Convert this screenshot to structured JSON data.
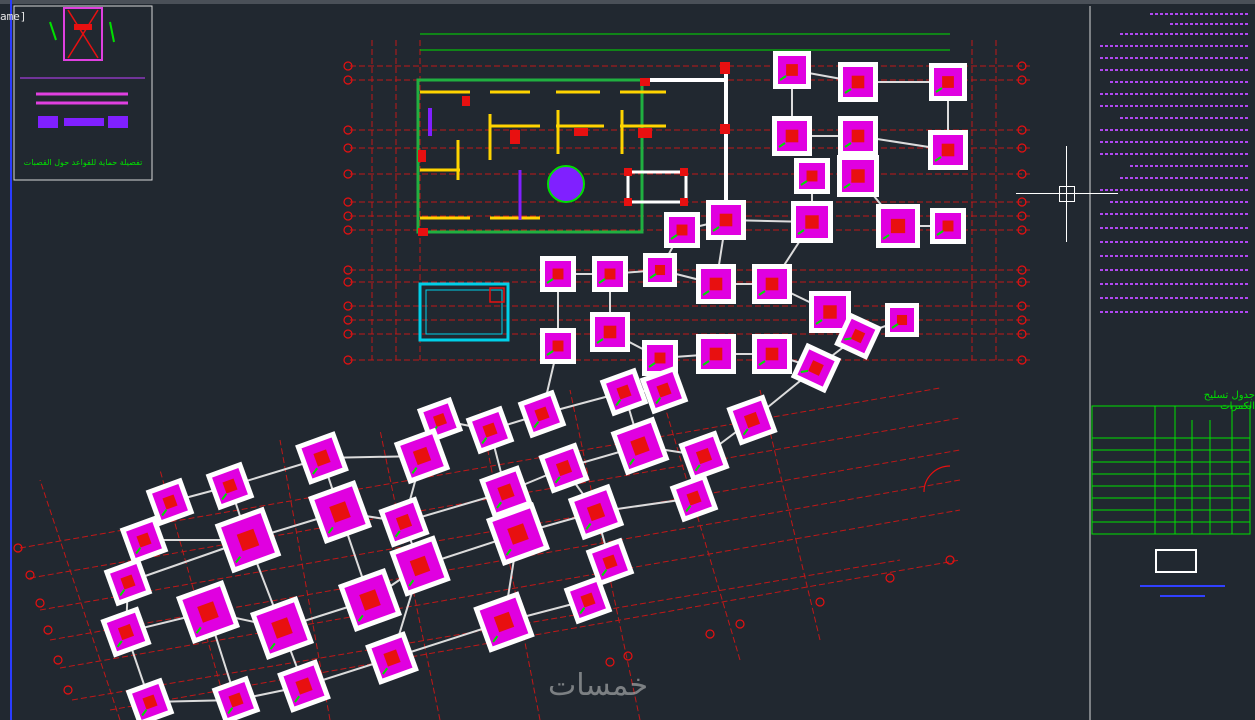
{
  "viewport": {
    "label": "ame]"
  },
  "watermark": {
    "text": "خمسات"
  },
  "detail": {
    "caption": "تفصيلة حماية للقواعد حول القصبات"
  },
  "schedule": {
    "title": "جدول تسليح الكمرات"
  },
  "colors": {
    "background": "#212830",
    "footing_outer": "#ffffff",
    "footing_mid": "#e000e0",
    "column": "#e81010",
    "grid": "#c01818",
    "beam": "#dcdcdc",
    "notes": "#c040ff",
    "table": "#00e000"
  },
  "icons": {
    "cursor": "crosshair-icon"
  }
}
